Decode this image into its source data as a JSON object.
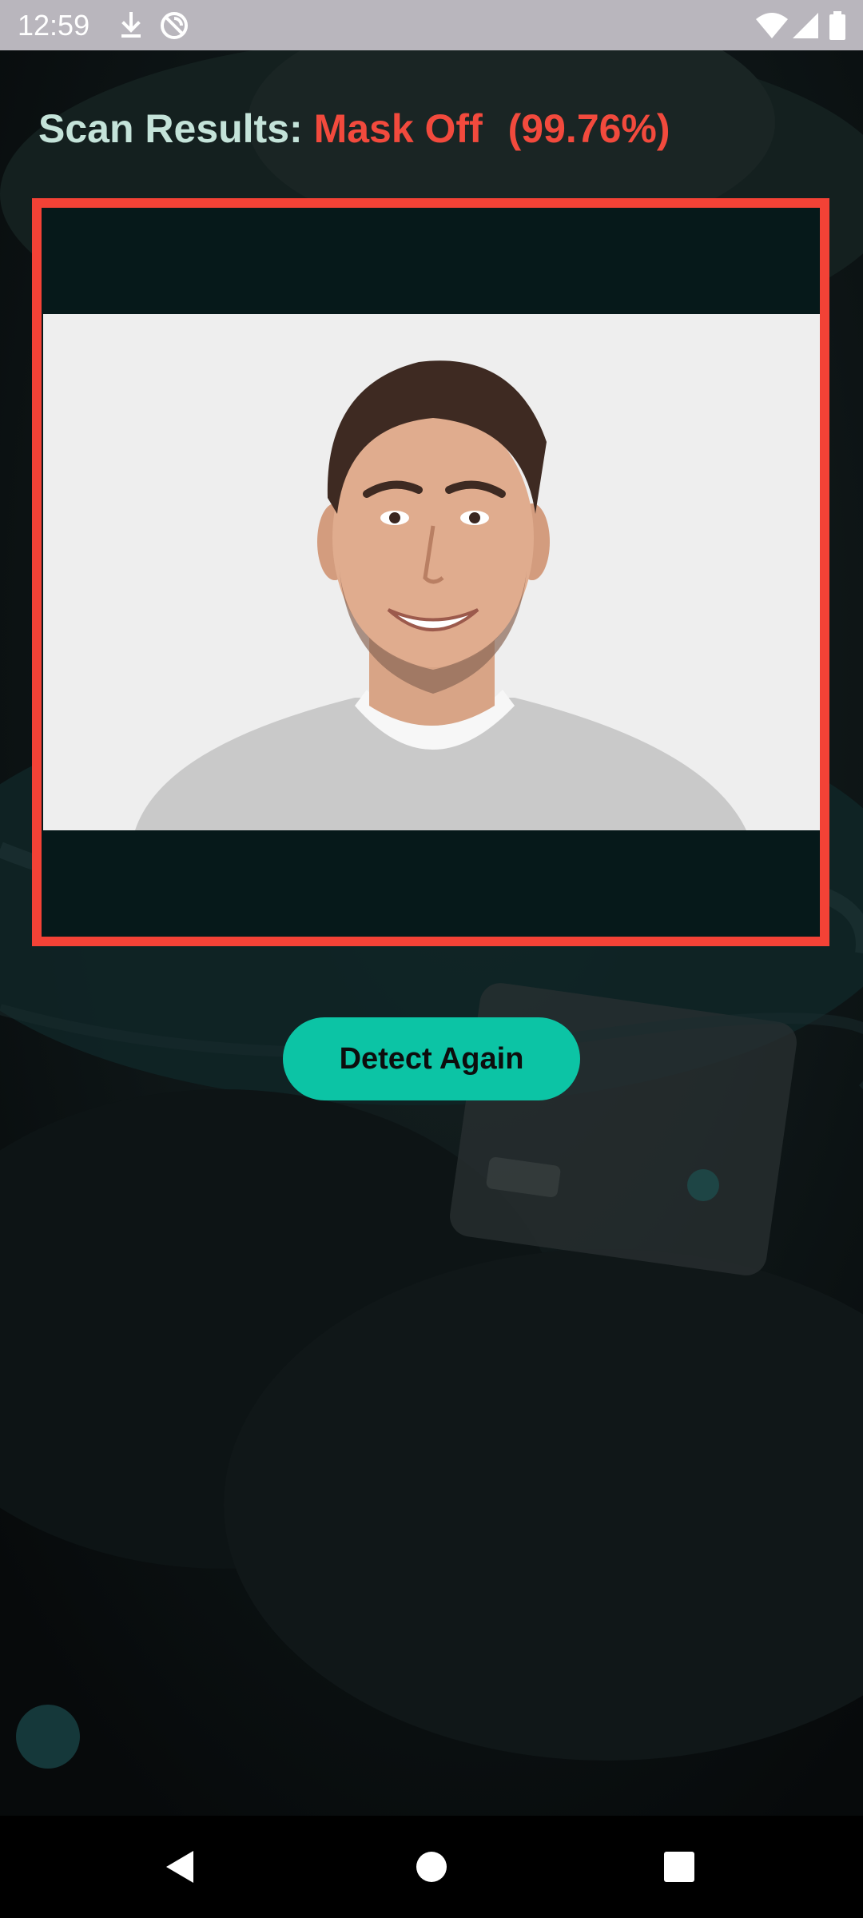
{
  "status_bar": {
    "time": "12:59",
    "icons": [
      "download-icon",
      "no-sync-icon",
      "wifi-icon",
      "signal-icon",
      "battery-icon"
    ]
  },
  "scan": {
    "label": "Scan Results:",
    "status": "Mask Off",
    "confidence": "(99.76%)",
    "status_color": "#f24a3d",
    "frame_color": "#f34236"
  },
  "actions": {
    "detect_again_label": "Detect Again",
    "button_color": "#0cc4a5"
  },
  "nav_bar": {
    "icons": [
      "back-icon",
      "home-icon",
      "recents-icon"
    ]
  }
}
